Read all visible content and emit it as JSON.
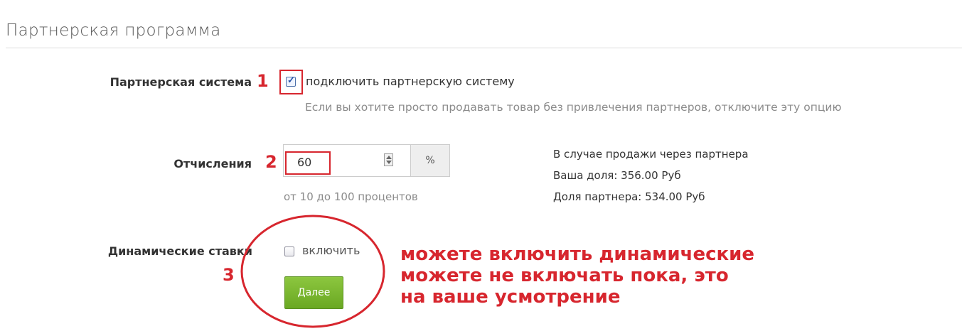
{
  "section": {
    "title": "Партнерская программа"
  },
  "partner_system": {
    "label": "Партнерская система",
    "annotation": "1",
    "checkbox_label": "подключить партнерскую систему",
    "checked": true,
    "hint": "Если вы хотите просто продавать товар без привлечения партнеров, отключите эту опцию"
  },
  "commission": {
    "label": "Отчисления",
    "annotation": "2",
    "value": "60",
    "unit": "%",
    "hint": "от 10 до 100 процентов",
    "info": {
      "line1": "В случае продажи через партнера",
      "line2": "Ваша доля: 356.00 Руб",
      "line3": "Доля партнера: 534.00 Руб"
    }
  },
  "dynamic_rates": {
    "label": "Динамические ставки",
    "annotation": "3",
    "checkbox_label": "включить",
    "checked": false
  },
  "next_button": {
    "label": "Далее"
  },
  "note": {
    "line1": "можете включить динамические",
    "line2": "можете не включать пока, это",
    "line3": "на ваше усмотрение"
  },
  "colors": {
    "annotation_red": "#d7262e",
    "button_green": "#7ab631"
  }
}
